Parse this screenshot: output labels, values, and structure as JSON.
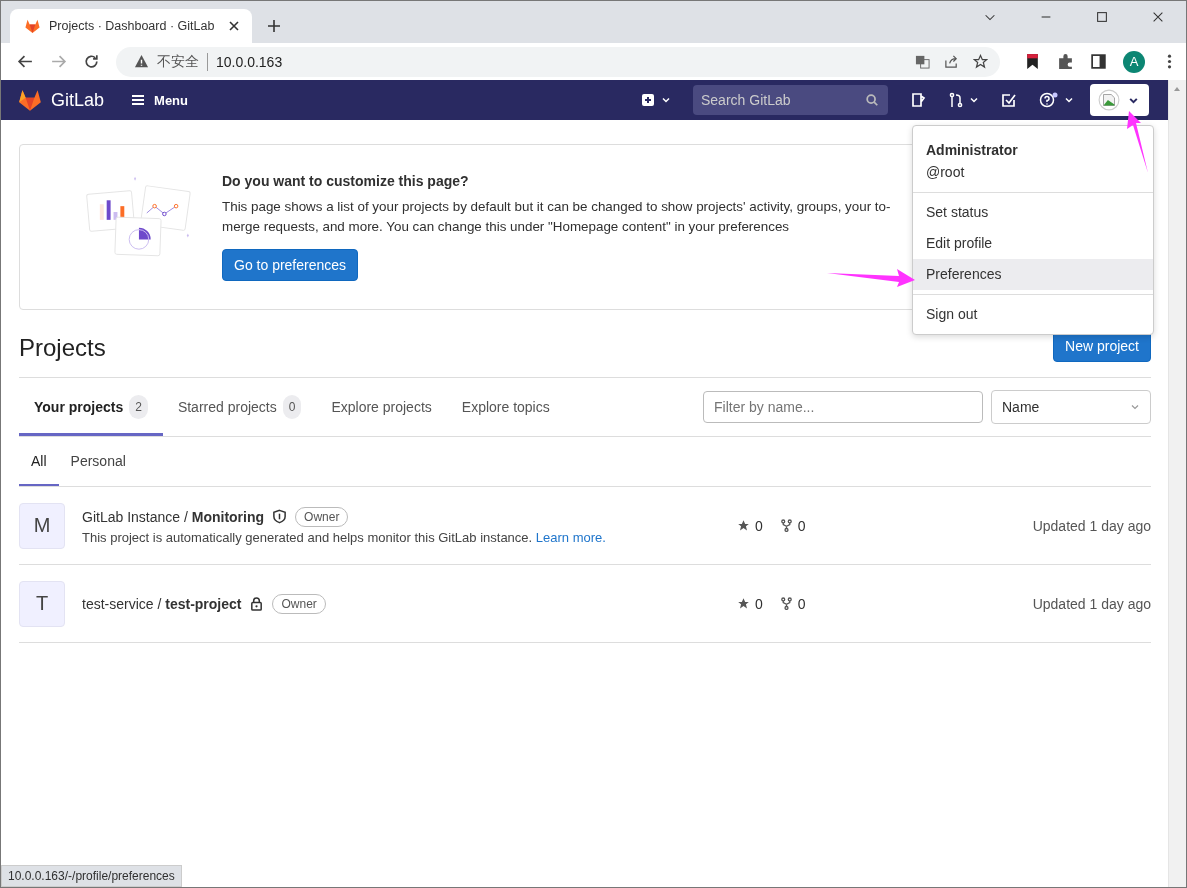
{
  "browser": {
    "tab_title": "Projects · Dashboard · GitLab",
    "warning": "不安全",
    "url": "10.0.0.163",
    "profile_initial": "A",
    "status_url": "10.0.0.163/-/profile/preferences"
  },
  "navbar": {
    "brand": "GitLab",
    "menu": "Menu",
    "search_placeholder": "Search GitLab"
  },
  "user_menu": {
    "name": "Administrator",
    "username": "@root",
    "items": [
      {
        "label": "Set status",
        "selected": false
      },
      {
        "label": "Edit profile",
        "selected": false
      },
      {
        "label": "Preferences",
        "selected": true
      }
    ],
    "footer_items": [
      {
        "label": "Sign out",
        "selected": false
      }
    ]
  },
  "banner": {
    "title": "Do you want to customize this page?",
    "text_lines": [
      "This page shows a list of your projects by default but it can be changed to show projects' activity, groups, your to-",
      "merge requests, and more. You can change this under \"Homepage content\" in your preferences"
    ],
    "button": "Go to preferences"
  },
  "page": {
    "title": "Projects",
    "new_button": "New project"
  },
  "tabs": [
    {
      "label": "Your projects",
      "count": "2",
      "selected": true
    },
    {
      "label": "Starred projects",
      "count": "0",
      "selected": false
    },
    {
      "label": "Explore projects",
      "selected": false
    },
    {
      "label": "Explore topics",
      "selected": false
    }
  ],
  "filter": {
    "placeholder": "Filter by name..."
  },
  "sort": {
    "value": "Name"
  },
  "subtabs": [
    {
      "label": "All",
      "selected": true
    },
    {
      "label": "Personal",
      "selected": false
    }
  ],
  "projects": [
    {
      "avatar": "M",
      "path": "GitLab Instance / **Monitoring**",
      "kind": "internal",
      "role": "Owner",
      "description": "This project is automatically generated and helps monitor this GitLab instance.",
      "link": "Learn more.",
      "stars": "0",
      "forks": "0",
      "updated": "Updated 1 day ago"
    },
    {
      "avatar": "T",
      "path": "test-service / **test-project**",
      "kind": "private",
      "role": "Owner",
      "stars": "0",
      "forks": "0",
      "updated": "Updated 1 day ago"
    }
  ]
}
